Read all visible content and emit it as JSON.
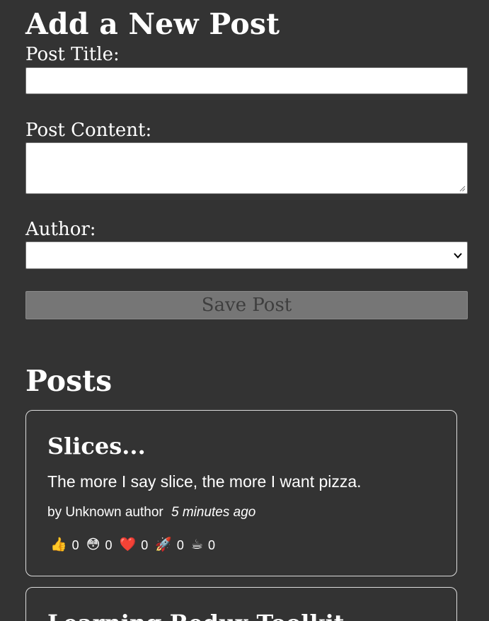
{
  "form": {
    "title": "Add a New Post",
    "post_title_label": "Post Title:",
    "post_title_value": "",
    "post_content_label": "Post Content:",
    "post_content_value": "",
    "author_label": "Author:",
    "author_selected": "",
    "save_label": "Save Post"
  },
  "posts_section": {
    "title": "Posts",
    "posts": [
      {
        "title": "Slices...",
        "content": "The more I say slice, the more I want pizza.",
        "author": "by Unknown author",
        "time": "5 minutes ago",
        "reactions": [
          {
            "icon": "thumbs-up-icon",
            "glyph": "👍",
            "count": "0"
          },
          {
            "icon": "hooray-icon",
            "glyph": "😳",
            "count": "0"
          },
          {
            "icon": "heart-icon",
            "glyph": "❤️",
            "count": "0"
          },
          {
            "icon": "rocket-icon",
            "glyph": "🚀",
            "count": "0"
          },
          {
            "icon": "coffee-icon",
            "glyph": "☕",
            "count": "0"
          }
        ]
      },
      {
        "title": "Learning Redux Toolkit"
      }
    ]
  }
}
